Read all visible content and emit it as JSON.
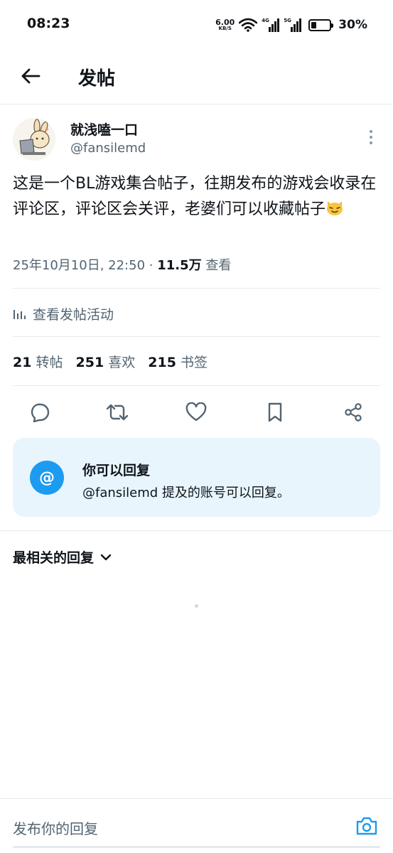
{
  "status_bar": {
    "time": "08:23",
    "net_speed": "6.00",
    "net_unit": "KB/S",
    "sim1_tag": "4G",
    "sim2_tag": "5G",
    "battery_pct": "30%",
    "battery_level": 0.3
  },
  "header": {
    "title": "发帖",
    "back_icon": "arrow-left-icon"
  },
  "author": {
    "name": "就浅嗑一口",
    "handle": "@fansilemd"
  },
  "post": {
    "text": "这是一个BL游戏集合帖子，往期发布的游戏会收录在评论区，评论区会关评，老婆们可以收藏帖子",
    "emoji": "cat-face-emoji",
    "datetime": "25年10月10日, 22:50 · ",
    "views": "11.5万",
    "views_label": " 查看"
  },
  "activity": {
    "label": "查看发帖活动"
  },
  "stats": {
    "reposts": "21",
    "reposts_label": "转帖",
    "likes": "251",
    "likes_label": "喜欢",
    "bookmarks": "215",
    "bookmarks_label": "书签"
  },
  "actions": [
    "reply-icon",
    "repost-icon",
    "like-icon",
    "bookmark-icon",
    "share-icon"
  ],
  "reply_notice": {
    "icon": "@",
    "title": "你可以回复",
    "desc": "@fansilemd 提及的账号可以回复。"
  },
  "replies": {
    "sort_label": "最相关的回复"
  },
  "compose": {
    "placeholder": "发布你的回复"
  },
  "colors": {
    "accent": "#1d9bf0",
    "text_primary": "#0f1419",
    "text_secondary": "#536471",
    "notice_bg": "#e8f5fd"
  }
}
